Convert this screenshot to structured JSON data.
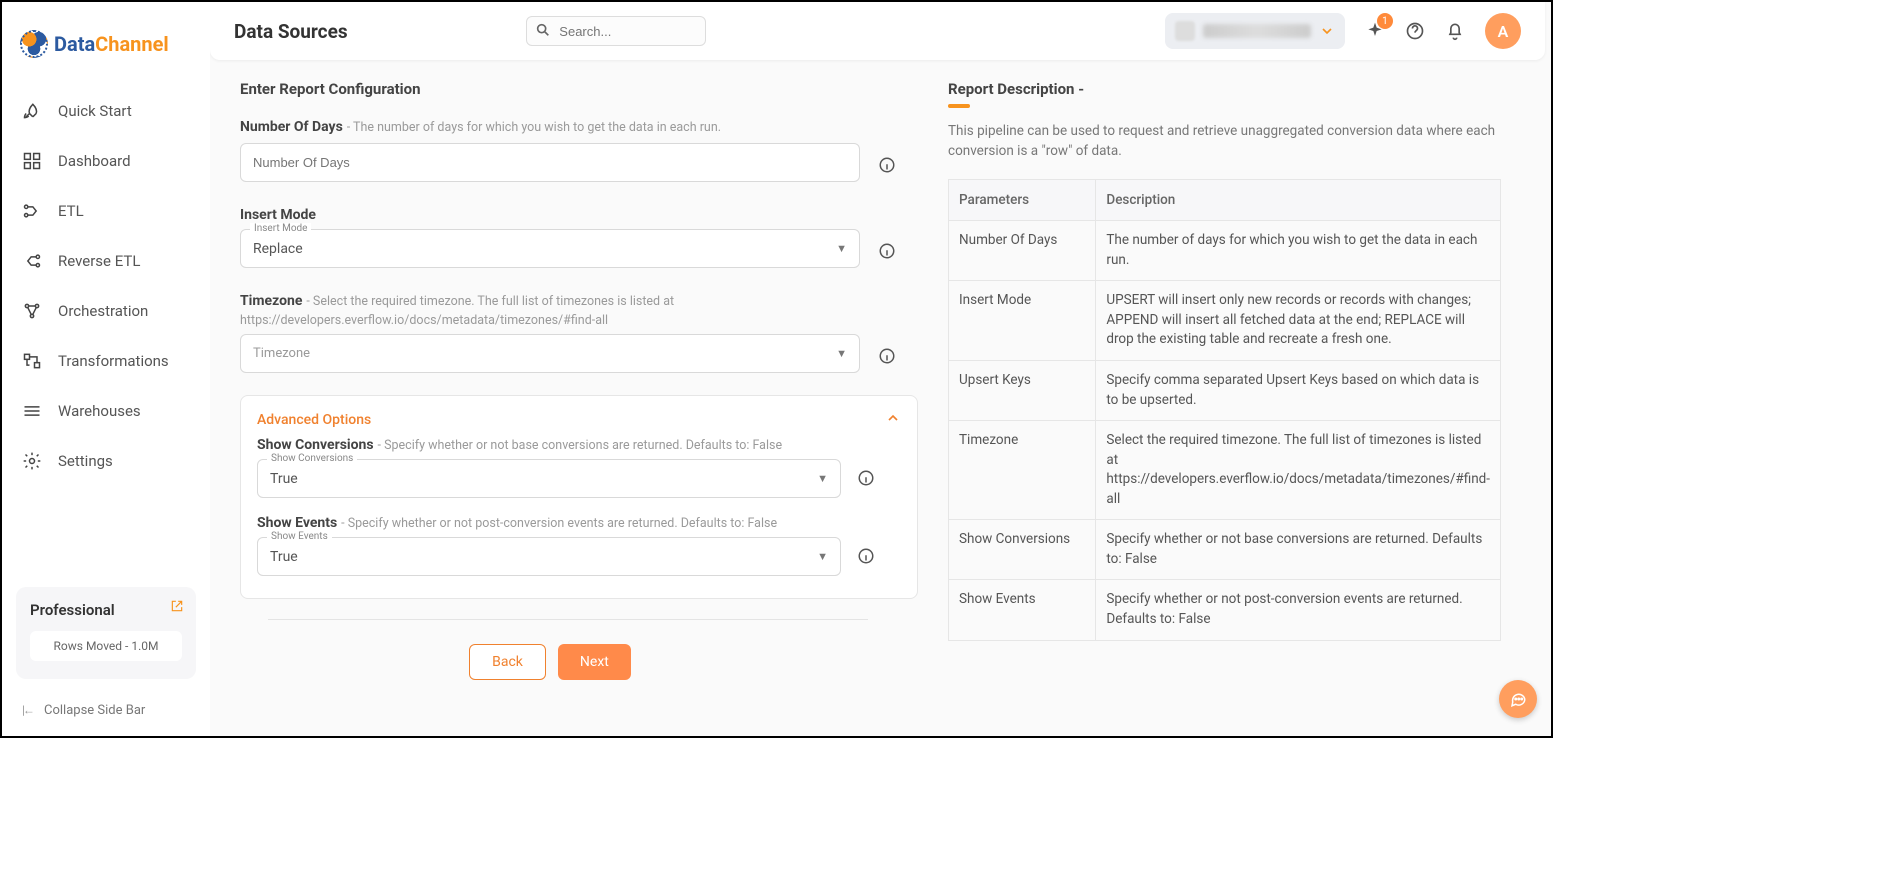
{
  "brand": {
    "data": "Data",
    "channel": "Channel"
  },
  "sidebar": {
    "items": [
      {
        "label": "Quick Start"
      },
      {
        "label": "Dashboard"
      },
      {
        "label": "ETL"
      },
      {
        "label": "Reverse ETL"
      },
      {
        "label": "Orchestration"
      },
      {
        "label": "Transformations"
      },
      {
        "label": "Warehouses"
      },
      {
        "label": "Settings"
      }
    ],
    "plan": {
      "name": "Professional",
      "rows": "Rows Moved - 1.0M"
    },
    "collapse": "Collapse Side Bar"
  },
  "header": {
    "title": "Data Sources",
    "search_placeholder": "Search...",
    "badge_count": "1",
    "avatar_initial": "A"
  },
  "form": {
    "section_title": "Enter Report Configuration",
    "num_days": {
      "label": "Number Of Days",
      "hint": " - The number of days for which you wish to get the data in each run.",
      "placeholder": "Number Of Days"
    },
    "insert_mode": {
      "label": "Insert Mode",
      "float": "Insert Mode",
      "value": "Replace"
    },
    "timezone": {
      "label": "Timezone",
      "hint": " - Select the required timezone. The full list of timezones is listed at https://developers.everflow.io/docs/metadata/timezones/#find-all",
      "placeholder": "Timezone"
    },
    "advanced": {
      "title": "Advanced Options",
      "show_conversions": {
        "label": "Show Conversions",
        "hint": " - Specify whether or not base conversions are returned. Defaults to: False",
        "float": "Show Conversions",
        "value": "True"
      },
      "show_events": {
        "label": "Show Events",
        "hint": " - Specify whether or not post-conversion events are returned. Defaults to: False",
        "float": "Show Events",
        "value": "True"
      }
    },
    "buttons": {
      "back": "Back",
      "next": "Next"
    }
  },
  "description": {
    "title": "Report Description -",
    "text": "This pipeline can be used to request and retrieve unaggregated conversion data where each conversion is a \"row\" of data.",
    "table": {
      "headers": {
        "param": "Parameters",
        "desc": "Description"
      },
      "rows": [
        {
          "param": "Number Of Days",
          "desc": "The number of days for which you wish to get the data in each run."
        },
        {
          "param": "Insert Mode",
          "desc": "UPSERT will insert only new records or records with changes; APPEND will insert all fetched data at the end; REPLACE will drop the existing table and recreate a fresh one."
        },
        {
          "param": "Upsert Keys",
          "desc": "Specify comma separated Upsert Keys based on which data is to be upserted."
        },
        {
          "param": "Timezone",
          "desc": "Select the required timezone. The full list of timezones is listed at https://developers.everflow.io/docs/metadata/timezones/#find-all"
        },
        {
          "param": "Show Conversions",
          "desc": "Specify whether or not base conversions are returned. Defaults to: False"
        },
        {
          "param": "Show Events",
          "desc": "Specify whether or not post-conversion events are returned. Defaults to: False"
        }
      ]
    }
  }
}
